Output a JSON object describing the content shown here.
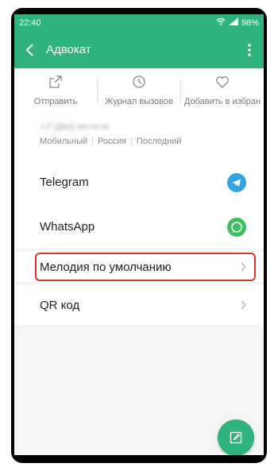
{
  "status": {
    "time": "22:40",
    "battery": "98%"
  },
  "appbar": {
    "title": "Адвокат"
  },
  "actions": [
    {
      "label": "Отправить"
    },
    {
      "label": "Журнал вызовов"
    },
    {
      "label": "Добавить в избран"
    }
  ],
  "contact": {
    "number": "+7 (9••) •••-••-••",
    "meta": [
      "Мобильный",
      "Россия",
      "Последний"
    ]
  },
  "rows": [
    {
      "label": "Telegram",
      "icon": "telegram-icon"
    },
    {
      "label": "WhatsApp",
      "icon": "whatsapp-icon"
    },
    {
      "label": "Мелодия по умолчанию"
    },
    {
      "label": "QR код"
    }
  ],
  "colors": {
    "accent": "#2fb27b",
    "highlight": "#d9342b",
    "telegram": "#2ea5e0",
    "whatsapp": "#3dbf61"
  }
}
